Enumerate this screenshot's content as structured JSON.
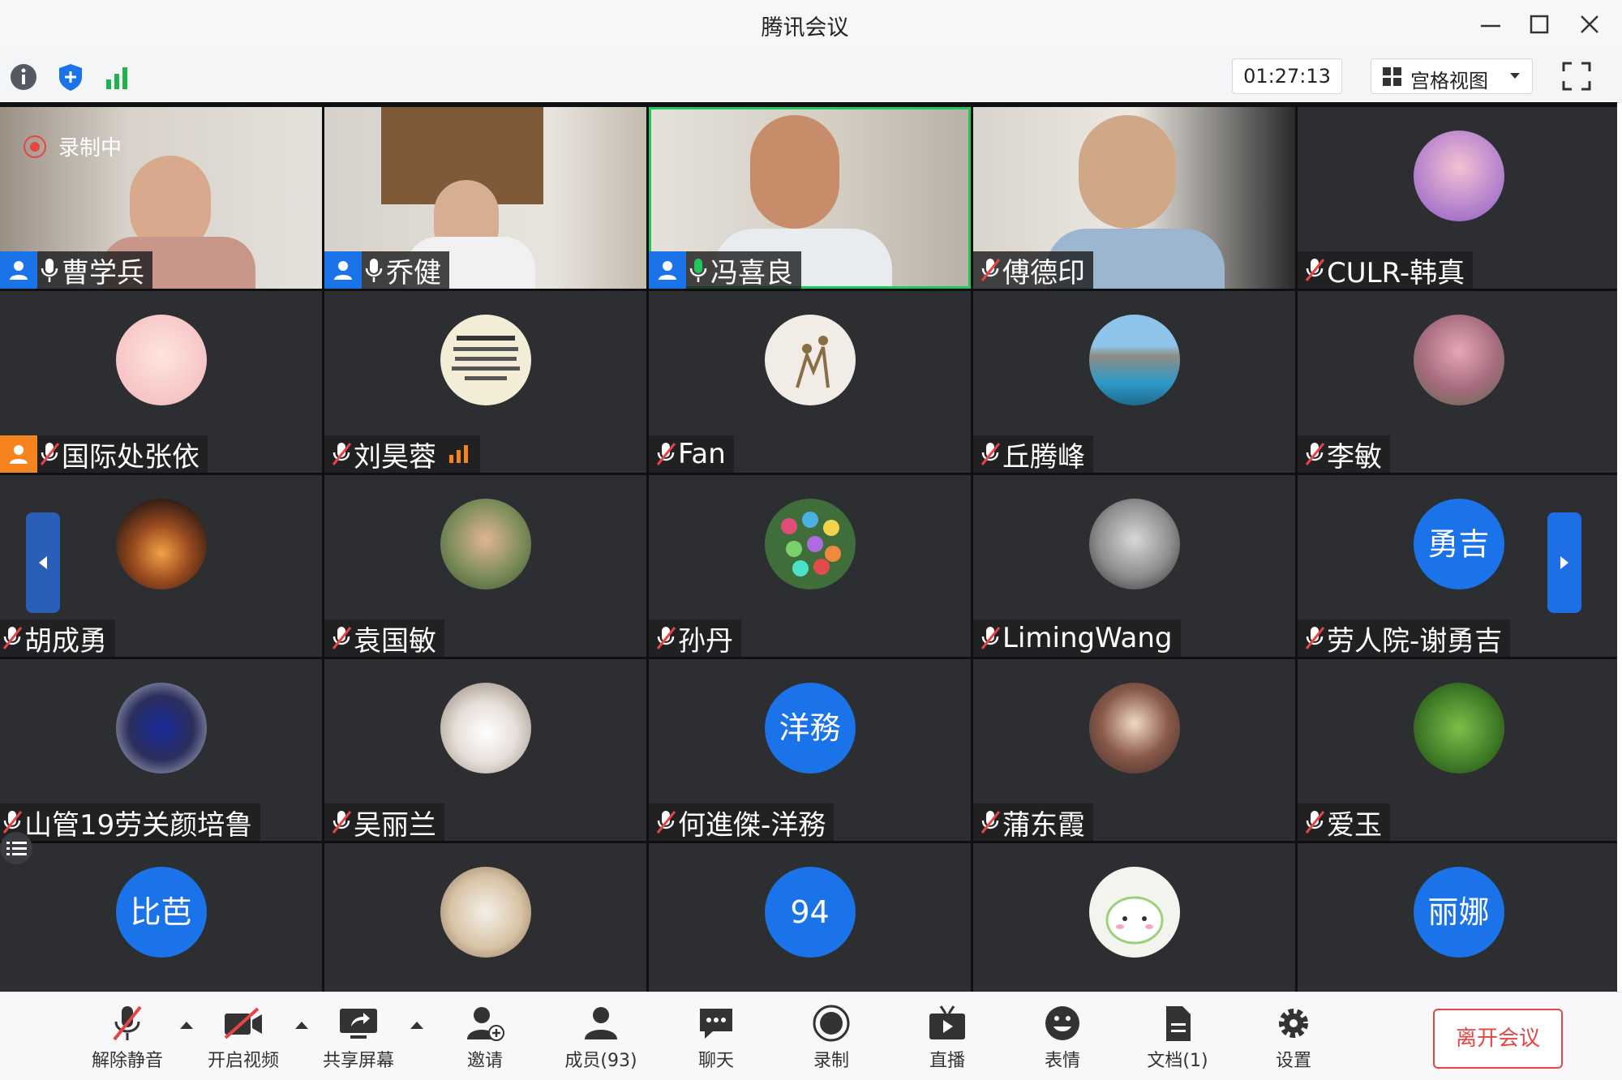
{
  "window": {
    "title": "腾讯会议"
  },
  "toolbar": {
    "timer": "01:27:13",
    "view_label": "宫格视图"
  },
  "recording": {
    "label": "录制中"
  },
  "participants": [
    {
      "name": "曹学兵"
    },
    {
      "name": "乔健"
    },
    {
      "name": "冯喜良"
    },
    {
      "name": "傅德印"
    },
    {
      "name": "CULR-韩真"
    },
    {
      "name": "国际处张依"
    },
    {
      "name": "刘昊蓉"
    },
    {
      "name": "Fan"
    },
    {
      "name": "丘腾峰"
    },
    {
      "name": "李敏"
    },
    {
      "name": "胡成勇"
    },
    {
      "name": "袁国敏"
    },
    {
      "name": "孙丹"
    },
    {
      "name": "LimingWang"
    },
    {
      "name": "劳人院-谢勇吉",
      "avatar_text": "勇吉"
    },
    {
      "name": "山管19劳关颜培鲁"
    },
    {
      "name": "吴丽兰"
    },
    {
      "name": "何進傑-洋務",
      "avatar_text": "洋務"
    },
    {
      "name": "蒲东霞"
    },
    {
      "name": "爱玉"
    },
    {
      "avatar_text": "比芭"
    },
    {},
    {
      "avatar_text": "94"
    },
    {},
    {
      "avatar_text": "丽娜"
    }
  ],
  "bottombar": {
    "unmute": "解除静音",
    "start_video": "开启视频",
    "share_screen": "共享屏幕",
    "invite": "邀请",
    "members": "成员(93)",
    "chat": "聊天",
    "record": "录制",
    "live": "直播",
    "emoji": "表情",
    "docs": "文档(1)",
    "settings": "设置",
    "leave": "离开会议"
  },
  "colors": {
    "accent_blue": "#1a73e8",
    "host_orange": "#f5841f",
    "speaking_green": "#23c55e",
    "leave_red": "#e64545",
    "tile_bg": "#2c2e32"
  }
}
